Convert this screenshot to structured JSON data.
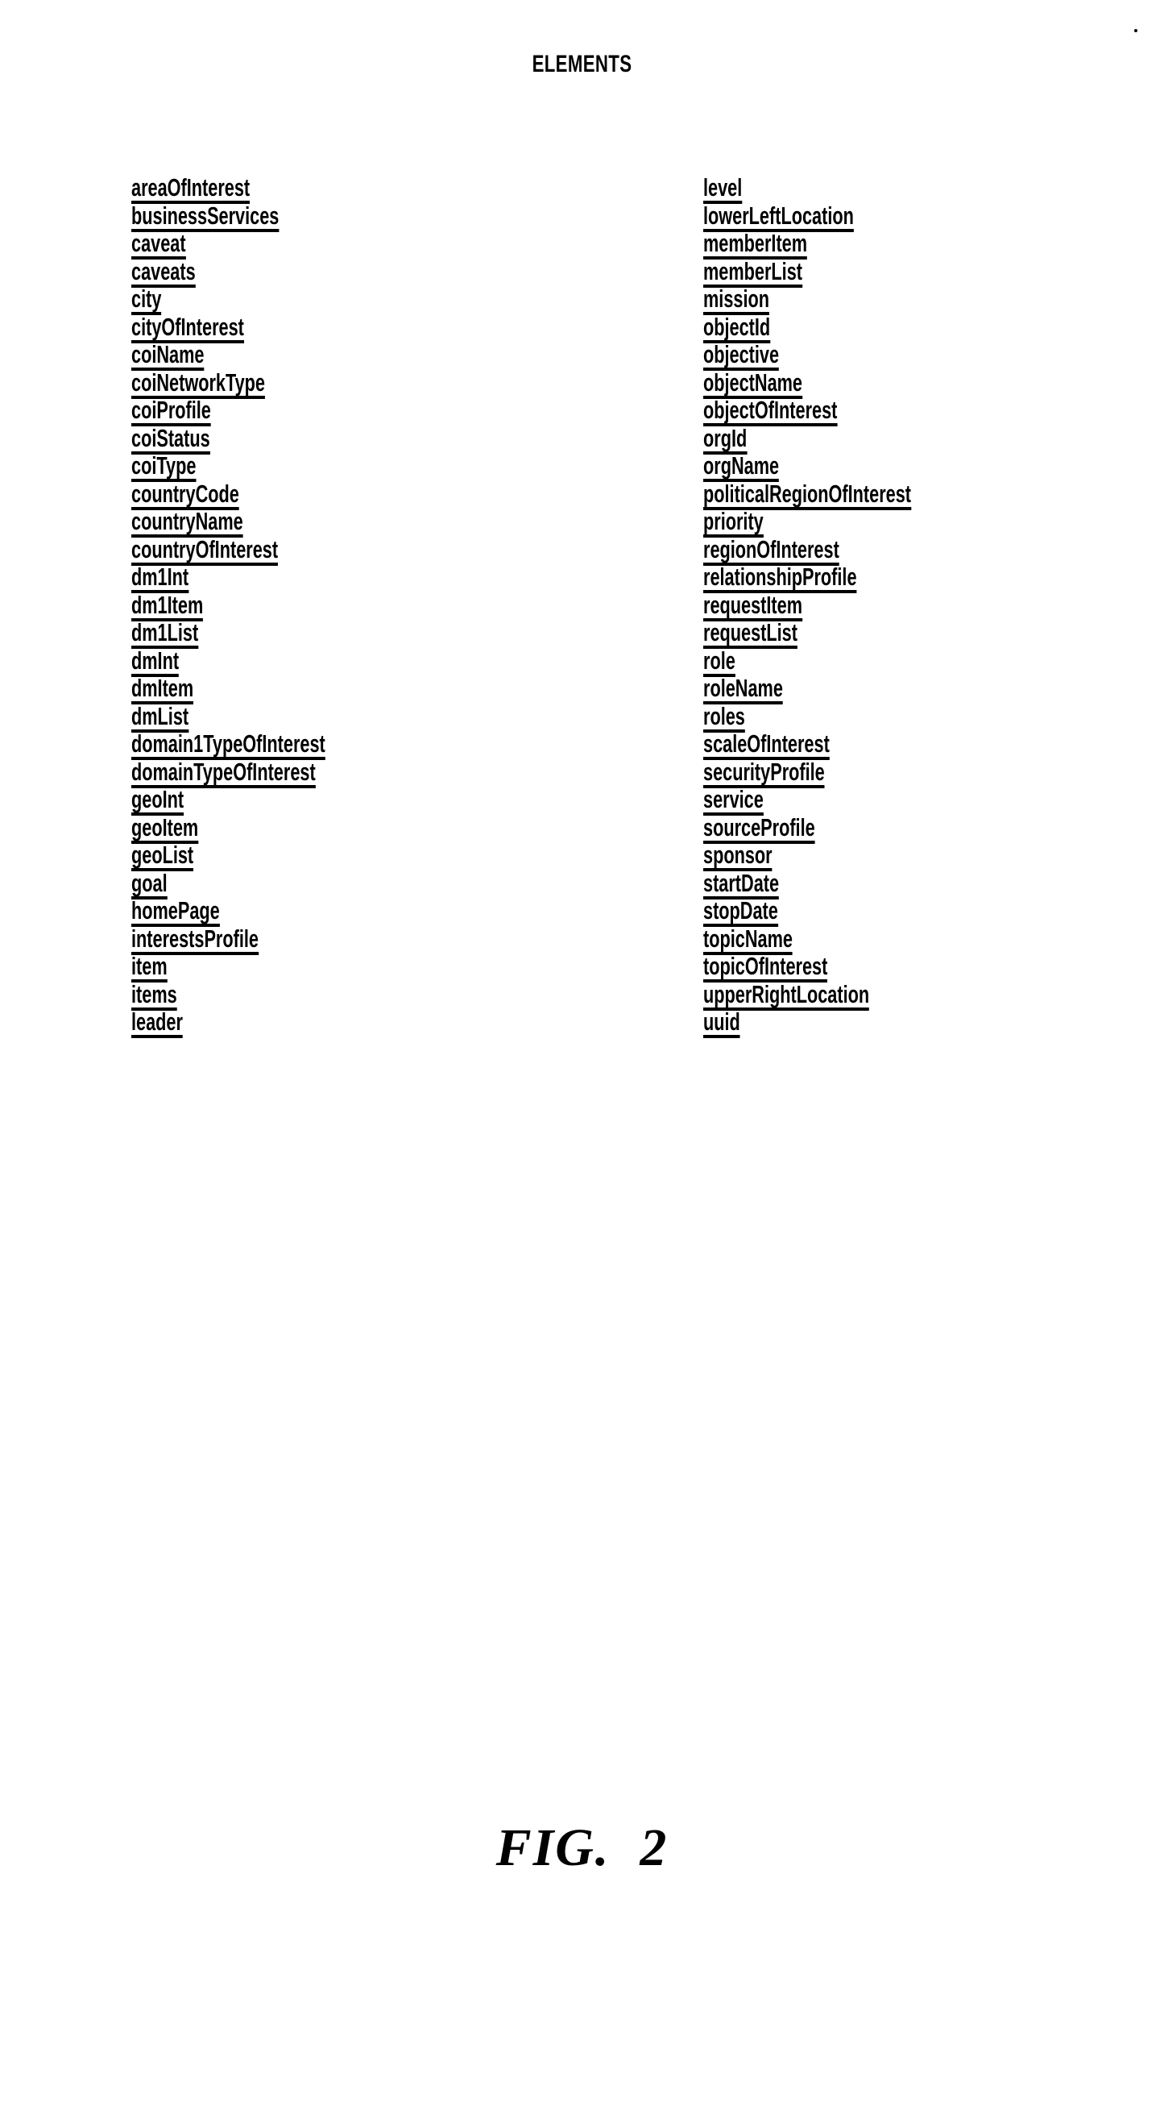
{
  "figure": {
    "title": "ELEMENTS",
    "caption": "FIG.  2",
    "ink_color": "#000000",
    "background_color": "#ffffff"
  },
  "columns": {
    "left": [
      "areaOfInterest",
      "businessServices",
      "caveat",
      "caveats",
      "city",
      "cityOfInterest",
      "coiName",
      "coiNetworkType",
      "coiProfile",
      "coiStatus",
      "coiType",
      "countryCode",
      "countryName",
      "countryOfInterest",
      "dm1Int",
      "dm1Item",
      "dm1List",
      "dmInt",
      "dmItem",
      "dmList",
      "domain1TypeOfInterest",
      "domainTypeOfInterest",
      "geoInt",
      "geoItem",
      "geoList",
      "goal",
      "homePage",
      "interestsProfile",
      "item",
      "items",
      "leader"
    ],
    "right": [
      "level",
      "lowerLeftLocation",
      "memberItem",
      "memberList",
      "mission",
      "objectId",
      "objective",
      "objectName",
      "objectOfInterest",
      "orgId",
      "orgName",
      "politicalRegionOfInterest",
      "priority",
      "regionOfInterest",
      "relationshipProfile",
      "requestItem",
      "requestList",
      "role",
      "roleName",
      "roles",
      "scaleOfInterest",
      "securityProfile",
      "service",
      "sourceProfile",
      "sponsor",
      "startDate",
      "stopDate",
      "topicName",
      "topicOfInterest",
      "upperRightLocation",
      "uuid"
    ]
  }
}
